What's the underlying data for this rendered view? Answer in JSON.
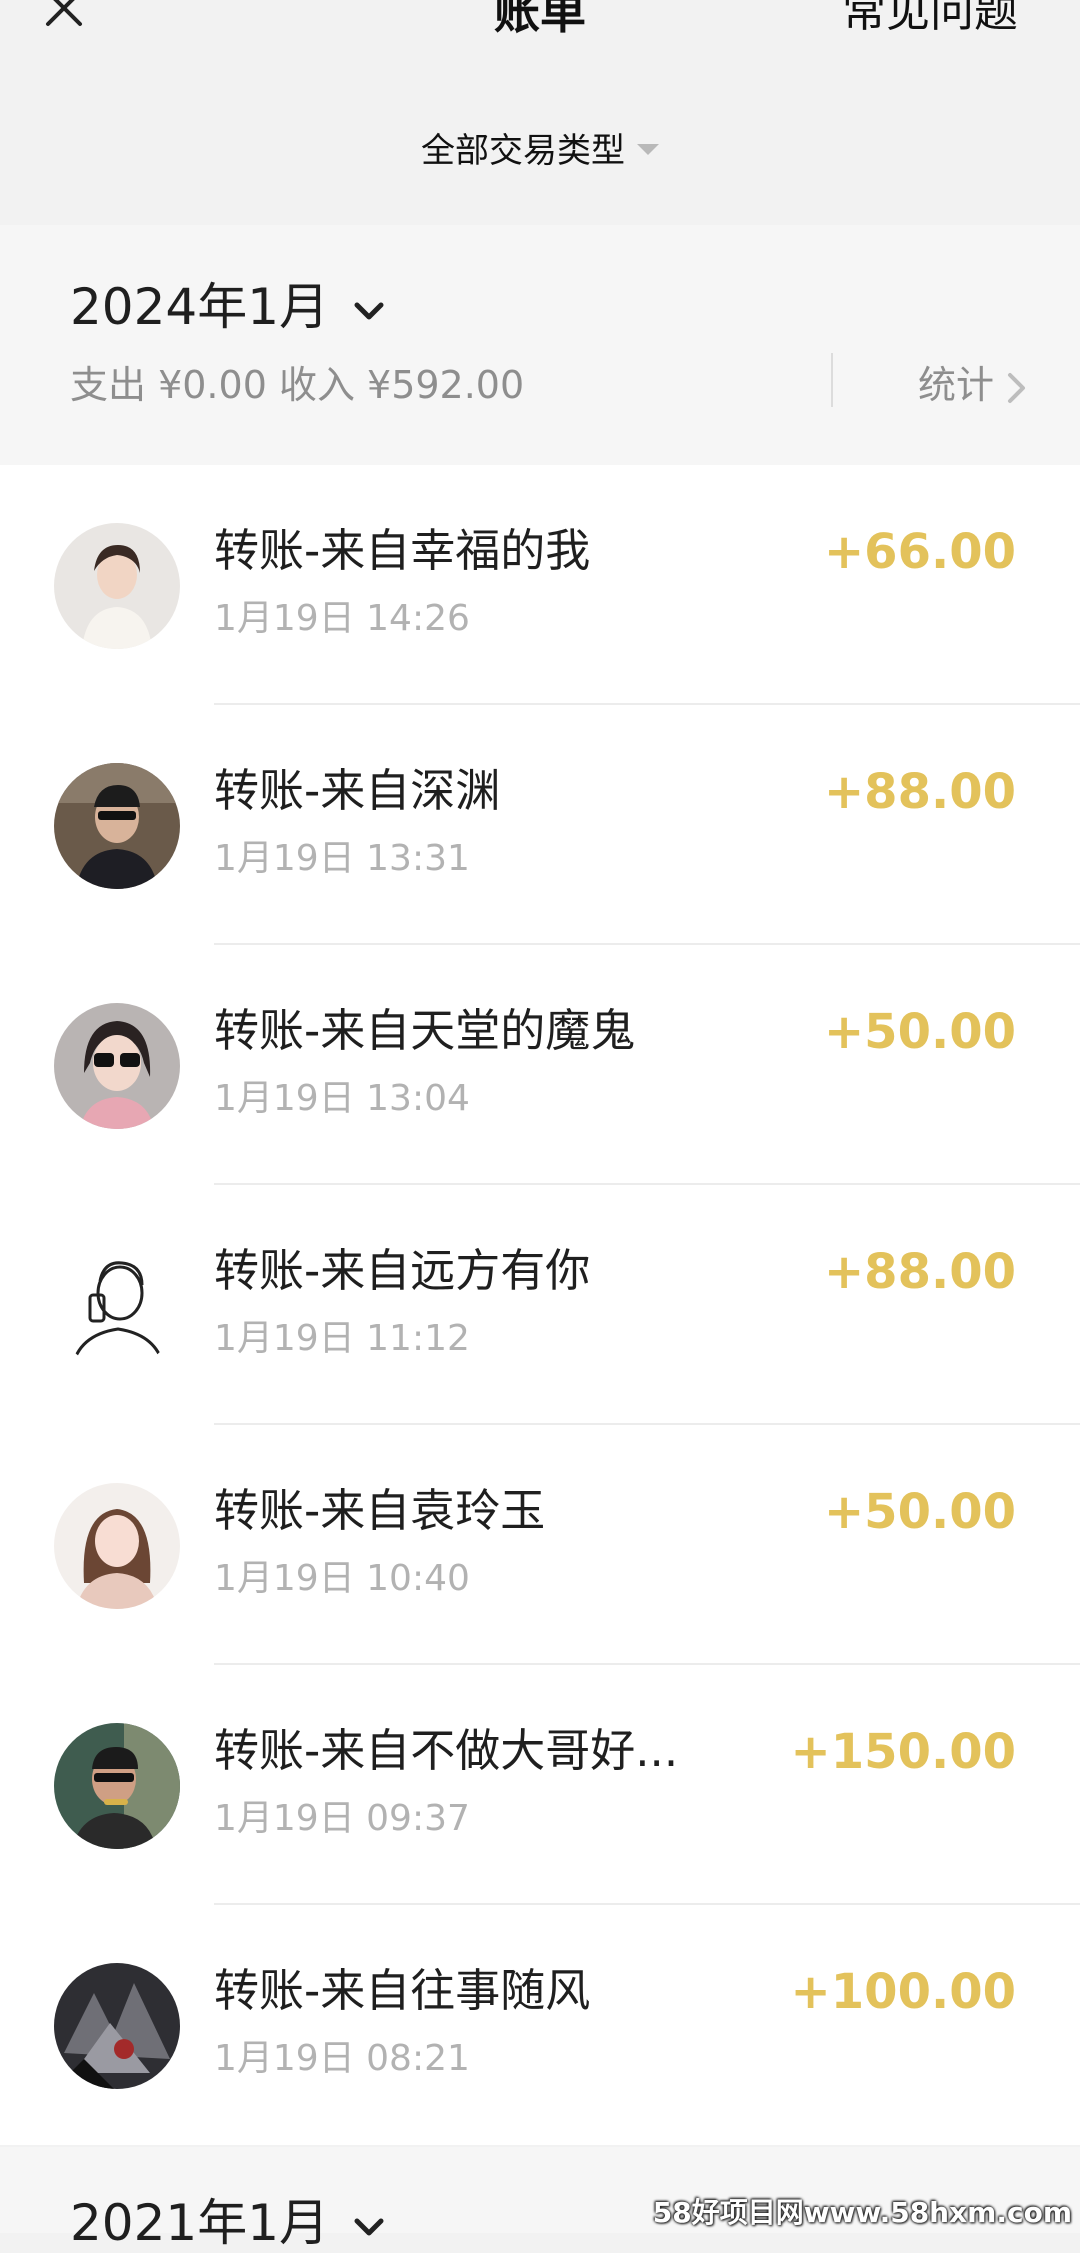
{
  "header": {
    "title": "账单",
    "faq_label": "常见问题",
    "filter_label": "全部交易类型"
  },
  "month_section": {
    "month_label": "2024年1月",
    "summary": "支出 ¥0.00 收入 ¥592.00",
    "stats_label": "统计"
  },
  "transactions": [
    {
      "name": "转账-来自幸福的我",
      "time": "1月19日 14:26",
      "amount": "+66.00"
    },
    {
      "name": "转账-来自深渊",
      "time": "1月19日 13:31",
      "amount": "+88.00"
    },
    {
      "name": "转账-来自天堂的魔鬼",
      "time": "1月19日 13:04",
      "amount": "+50.00"
    },
    {
      "name": "转账-来自远方有你",
      "time": "1月19日 11:12",
      "amount": "+88.00"
    },
    {
      "name": "转账-来自袁玲玉",
      "time": "1月19日 10:40",
      "amount": "+50.00"
    },
    {
      "name": "转账-来自不做大哥好...",
      "time": "1月19日 09:37",
      "amount": "+150.00"
    },
    {
      "name": "转账-来自往事随风",
      "time": "1月19日 08:21",
      "amount": "+100.00"
    }
  ],
  "next_month_label": "2021年1月",
  "watermark": "58好项目网www.58hxm.com",
  "colors": {
    "amount": "#e3c25b",
    "background": "#f2f2f2",
    "secondary_text": "#8e8e8e"
  }
}
